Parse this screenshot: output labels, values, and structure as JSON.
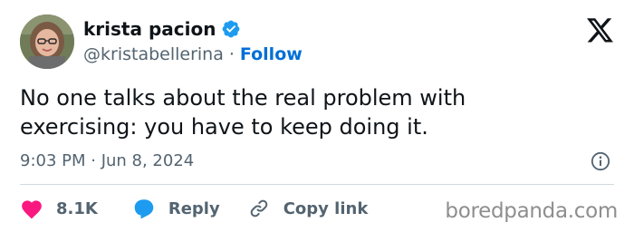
{
  "author": {
    "display_name": "krista pacion",
    "handle": "@kristabellerina",
    "separator": "·",
    "follow_label": "Follow",
    "verified": true
  },
  "tweet": {
    "text_lines": [
      "No one talks about the real problem with",
      "exercising: you have to keep doing it."
    ],
    "timestamp": "9:03 PM · Jun 8, 2024"
  },
  "actions": {
    "likes_count": "8.1K",
    "reply_label": "Reply",
    "copy_link_label": "Copy link"
  },
  "watermark": "boredpanda.com",
  "icons": {
    "platform_logo": "x-logo-icon",
    "verified": "verified-badge-icon",
    "info": "info-icon",
    "like": "heart-icon",
    "reply": "speech-bubble-icon",
    "copy": "link-icon"
  },
  "colors": {
    "text_primary": "#0f1419",
    "text_secondary": "#536471",
    "link_blue": "#006fd6",
    "verified_blue": "#1d9bf0",
    "heart_red": "#f91880",
    "divider": "#cfd9de",
    "watermark_gray": "#8e8e8e"
  }
}
